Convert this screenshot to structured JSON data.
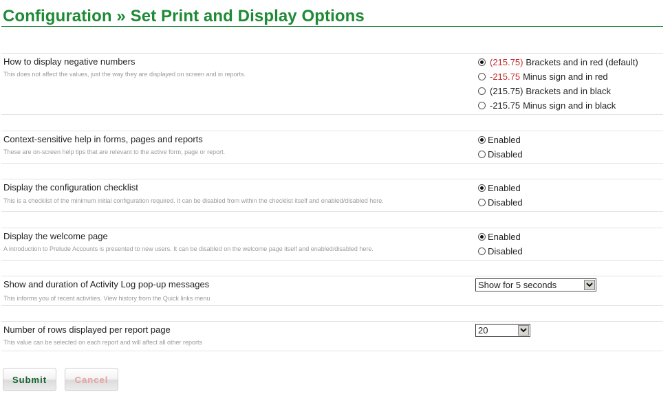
{
  "page": {
    "title": "Configuration » Set Print and Display Options"
  },
  "settings": [
    {
      "label": "How to display negative numbers",
      "description": "This does not affect the values, just the way they are displayed on screen and in reports.",
      "type": "radio",
      "options": [
        {
          "sample": "(215.75)",
          "sample_color": "red",
          "text": "Brackets and in red (default)",
          "checked": true
        },
        {
          "sample": "-215.75",
          "sample_color": "red",
          "text": "Minus sign and in red",
          "checked": false
        },
        {
          "sample": "(215.75)",
          "sample_color": "black",
          "text": "Brackets and in black",
          "checked": false
        },
        {
          "sample": "-215.75",
          "sample_color": "black",
          "text": "Minus sign and in black",
          "checked": false
        }
      ]
    },
    {
      "label": "Context-sensitive help in forms, pages and reports",
      "description": "These are on-screen help tips that are relevant to the active form, page or report.",
      "type": "radio",
      "options": [
        {
          "text": "Enabled",
          "checked": true
        },
        {
          "text": "Disabled",
          "checked": false
        }
      ]
    },
    {
      "label": "Display the configuration checklist",
      "description": "This is a checklist of the minimum initial configuration required. It can be disabled from within the checklist itself and enabled/disabled here.",
      "type": "radio",
      "options": [
        {
          "text": "Enabled",
          "checked": true
        },
        {
          "text": "Disabled",
          "checked": false
        }
      ]
    },
    {
      "label": "Display the welcome page",
      "description": "A introduction to Prelude Accounts is presented to new users. It can be disabled on the welcome page itself and enabled/disabled here.",
      "type": "radio",
      "options": [
        {
          "text": "Enabled",
          "checked": true
        },
        {
          "text": "Disabled",
          "checked": false
        }
      ]
    },
    {
      "label": "Show and duration of Activity Log pop-up messages",
      "description": "This informs you of recent activities. View history from the Quick links menu",
      "type": "select",
      "value": "Show for 5 seconds"
    },
    {
      "label": "Number of rows displayed per report page",
      "description": "This value can be selected on each report and will affect all other reports",
      "type": "select",
      "value": "20"
    }
  ],
  "buttons": {
    "submit": "Submit",
    "cancel": "Cancel"
  },
  "colors": {
    "title": "#1e8a35",
    "negative_red": "#c0282a",
    "submit_text": "#14622f",
    "cancel_text": "#e8a0a0"
  }
}
